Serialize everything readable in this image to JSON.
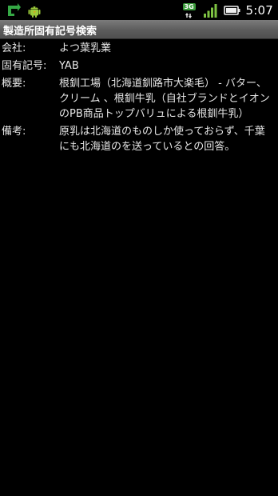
{
  "status_bar": {
    "network_badge": "3G",
    "time": "5:07",
    "icons": [
      "sync-icon",
      "android-debug-icon",
      "network-3g-icon",
      "signal-icon",
      "battery-icon"
    ]
  },
  "app": {
    "title": "製造所固有記号検索"
  },
  "details": [
    {
      "label": "会社:",
      "value": "よつ葉乳業"
    },
    {
      "label": "固有記号:",
      "value": "YAB"
    },
    {
      "label": "概要:",
      "value": "根釧工場（北海道釧路市大楽毛） - バター、クリーム 、根釧牛乳（自社ブランドとイオンのPB商品トップバリュによる根釧牛乳）"
    },
    {
      "label": "備考:",
      "value": "原乳は北海道のものしか使っておらず、千葉にも北海道のを送っているとの回答。"
    }
  ],
  "colors": {
    "background": "#000000",
    "titlebar": "#5c5c5c",
    "text": "#e6e6e6",
    "signal": "#7ec242"
  }
}
